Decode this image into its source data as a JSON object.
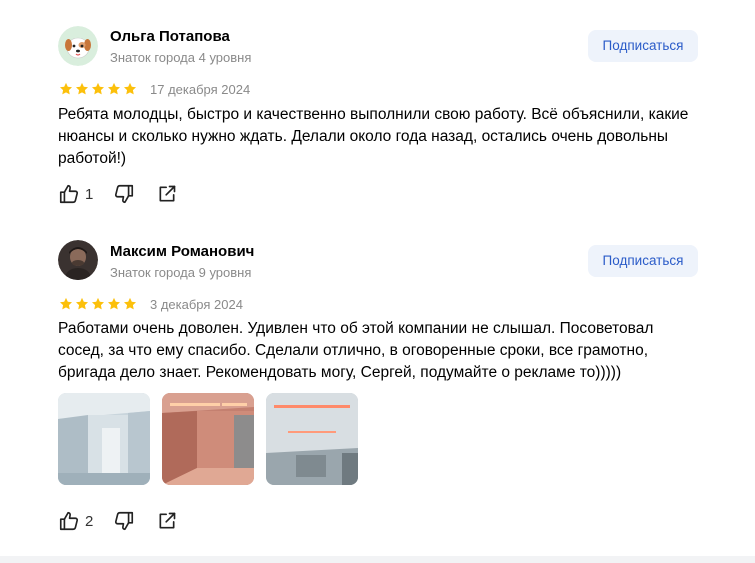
{
  "reviews": [
    {
      "author": "Ольга Потапова",
      "level": "Знаток города 4 уровня",
      "subscribe_label": "Подписаться",
      "rating": 5,
      "date": "17 декабря 2024",
      "text": "Ребята молодцы, быстро и качественно выполнили свою работу. Всё объяснили, какие нюансы и сколько нужно ждать. Делали около года назад, остались очень довольны работой!)",
      "likes": "1",
      "avatar_icon": "dog-emoji-avatar"
    },
    {
      "author": "Максим Романович",
      "level": "Знаток города 9 уровня",
      "subscribe_label": "Подписаться",
      "rating": 5,
      "date": "3 декабря 2024",
      "text": "Работами очень доволен. Удивлен что об этой компании не слышал. Посоветовал сосед, за что ему спасибо. Сделали отлично, в оговоренные сроки, все грамотно, бригада дело знает. Рекомендовать могу, Сергей, подумайте о рекламе то)))))",
      "likes": "2",
      "avatar_icon": "user-photo-avatar",
      "photos": [
        "room-photo-1",
        "room-photo-2",
        "ceiling-photo-3"
      ]
    }
  ],
  "colors": {
    "star": "#fcc00b",
    "subscribe_bg": "#eef3fb",
    "subscribe_text": "#2a5bc8",
    "meta_text": "#8a8a8a"
  }
}
